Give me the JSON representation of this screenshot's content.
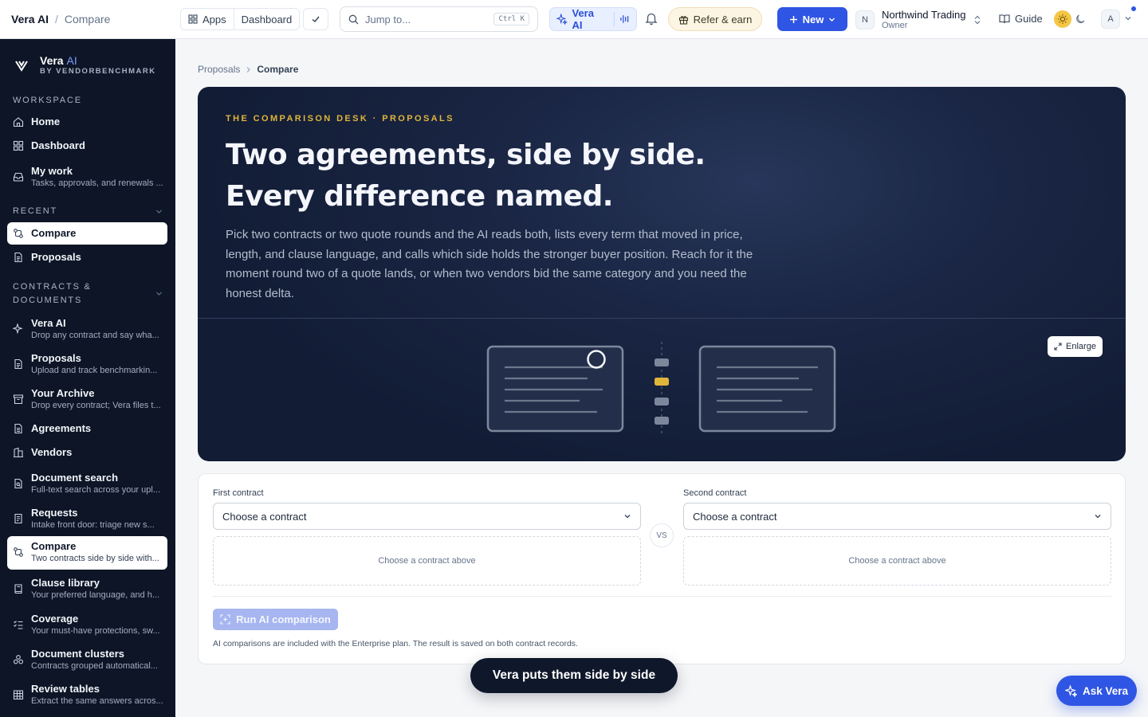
{
  "topbar": {
    "app_name": "Vera AI",
    "separator": "/",
    "page_name": "Compare",
    "apps_label": "Apps",
    "dashboard_label": "Dashboard",
    "search_placeholder": "Jump to...",
    "search_shortcut": "Ctrl K",
    "vera_label": "Vera AI",
    "refer_label": "Refer & earn",
    "new_label": "New",
    "org_initial": "N",
    "org_name": "Northwind Trading",
    "org_role": "Owner",
    "guide_label": "Guide",
    "avatar_initial": "A",
    "accent": "#2f55e4"
  },
  "sidebar": {
    "brand_name": "Vera",
    "brand_ai": "AI",
    "brand_by": "BY VENDORBENCHMARK",
    "workspace_label": "WORKSPACE",
    "recent_label": "RECENT",
    "contracts_label_1": "CONTRACTS &",
    "contracts_label_2": "DOCUMENTS",
    "workspace_items": [
      {
        "label": "Home",
        "icon": "home-icon"
      },
      {
        "label": "Dashboard",
        "icon": "grid-icon"
      },
      {
        "label": "My work",
        "sub": "Tasks, approvals, and renewals ...",
        "icon": "inbox-icon"
      }
    ],
    "recent_items": [
      {
        "label": "Compare",
        "icon": "compare-icon"
      },
      {
        "label": "Proposals",
        "icon": "document-icon"
      }
    ],
    "contract_items": [
      {
        "label": "Vera AI",
        "sub": "Drop any contract and say wha...",
        "icon": "sparkle-icon"
      },
      {
        "label": "Proposals",
        "sub": "Upload and track benchmarkin...",
        "icon": "document-icon"
      },
      {
        "label": "Your Archive",
        "sub": "Drop every contract; Vera files t...",
        "icon": "archive-icon"
      },
      {
        "label": "Agreements",
        "icon": "file-text-icon"
      },
      {
        "label": "Vendors",
        "icon": "building-icon"
      },
      {
        "label": "Document search",
        "sub": "Full-text search across your upl...",
        "icon": "file-search-icon"
      },
      {
        "label": "Requests",
        "sub": "Intake front door: triage new s...",
        "icon": "request-icon"
      },
      {
        "label": "Compare",
        "sub": "Two contracts side by side with...",
        "icon": "compare-icon"
      },
      {
        "label": "Clause library",
        "sub": "Your preferred language, and h...",
        "icon": "book-icon"
      },
      {
        "label": "Coverage",
        "sub": "Your must-have protections, sw...",
        "icon": "checklist-icon"
      },
      {
        "label": "Document clusters",
        "sub": "Contracts grouped automatical...",
        "icon": "cluster-icon"
      },
      {
        "label": "Review tables",
        "sub": "Extract the same answers acros...",
        "icon": "table-icon"
      }
    ]
  },
  "breadcrumb": {
    "parent": "Proposals",
    "current": "Compare"
  },
  "hero": {
    "eyebrow": "THE COMPARISON DESK · PROPOSALS",
    "title": "Two agreements, side by side. Every difference named.",
    "lede": "Pick two contracts or two quote rounds and the AI reads both, lists every term that moved in price, length, and clause language, and calls which side holds the stronger buyer position. Reach for it the moment round two of a quote lands, or when two vendors bid the same category and you need the honest delta.",
    "enlarge_label": "Enlarge",
    "highlight_color": "#e0b53b"
  },
  "compare_form": {
    "first_label": "First contract",
    "second_label": "Second contract",
    "first_value": "Choose a contract",
    "second_value": "Choose a contract",
    "first_empty": "Choose a contract above",
    "second_empty": "Choose a contract above",
    "vs_label": "VS",
    "run_label": "Run AI comparison",
    "note": "AI comparisons are included with the Enterprise plan. The result is saved on both contract records."
  },
  "toast": "Vera puts them side by side",
  "ask_vera_label": "Ask Vera"
}
